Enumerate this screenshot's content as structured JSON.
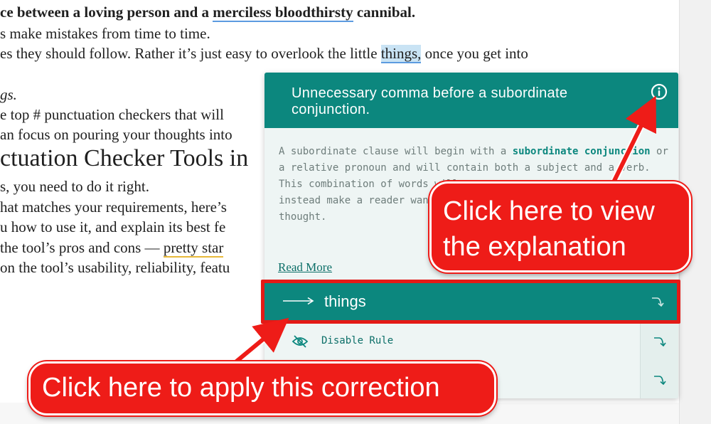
{
  "document": {
    "line1_pre": "ce between a loving person and a ",
    "line1_link": "merciless bloodthirsty",
    "line1_post": " cannibal.",
    "line2": "s make mistakes from time to time.",
    "line3_pre": "es they should follow. Rather it’s just easy to overlook the little ",
    "line3_hl": "things",
    "line3_comma": ",",
    "line3_post": " once you get into",
    "line4": "gs.",
    "line5": "e top # punctuation checkers that will",
    "line6": "an focus on pouring your thoughts into",
    "heading": "ctuation Checker Tools in",
    "line8": "s, you need to do it right.",
    "line9": "hat matches your requirements, here’s",
    "line10": "u how to use it, and explain its best fe",
    "line11_pre": " the tool’s pros and cons — ",
    "line11_u": "pretty star",
    "line12": "on the tool’s usability, reliability, featu"
  },
  "popup": {
    "title": "Unnecessary comma before a subordinate conjunction.",
    "info_icon": "info-circle-icon",
    "body_1": "A subordinate clause will begin with a ",
    "body_bold": "subordinate conjunction",
    "body_2": " or a relative pronoun and will contain both a subject and a verb. This combination of words will ",
    "body_3": "instead make a reader wan",
    "body_4": "thought.",
    "read_more": "Read More",
    "suggestion": "things",
    "disable_rule": "Disable Rule"
  },
  "callouts": {
    "explanation": "Click here to view\nthe explanation",
    "apply": "Click here to apply this correction"
  },
  "colors": {
    "accent": "#0c877e",
    "callout_red": "#ee1c18",
    "highlight": "#c9e3f4",
    "underline_blue": "#5c9be0",
    "underline_yellow": "#e8b93a"
  }
}
